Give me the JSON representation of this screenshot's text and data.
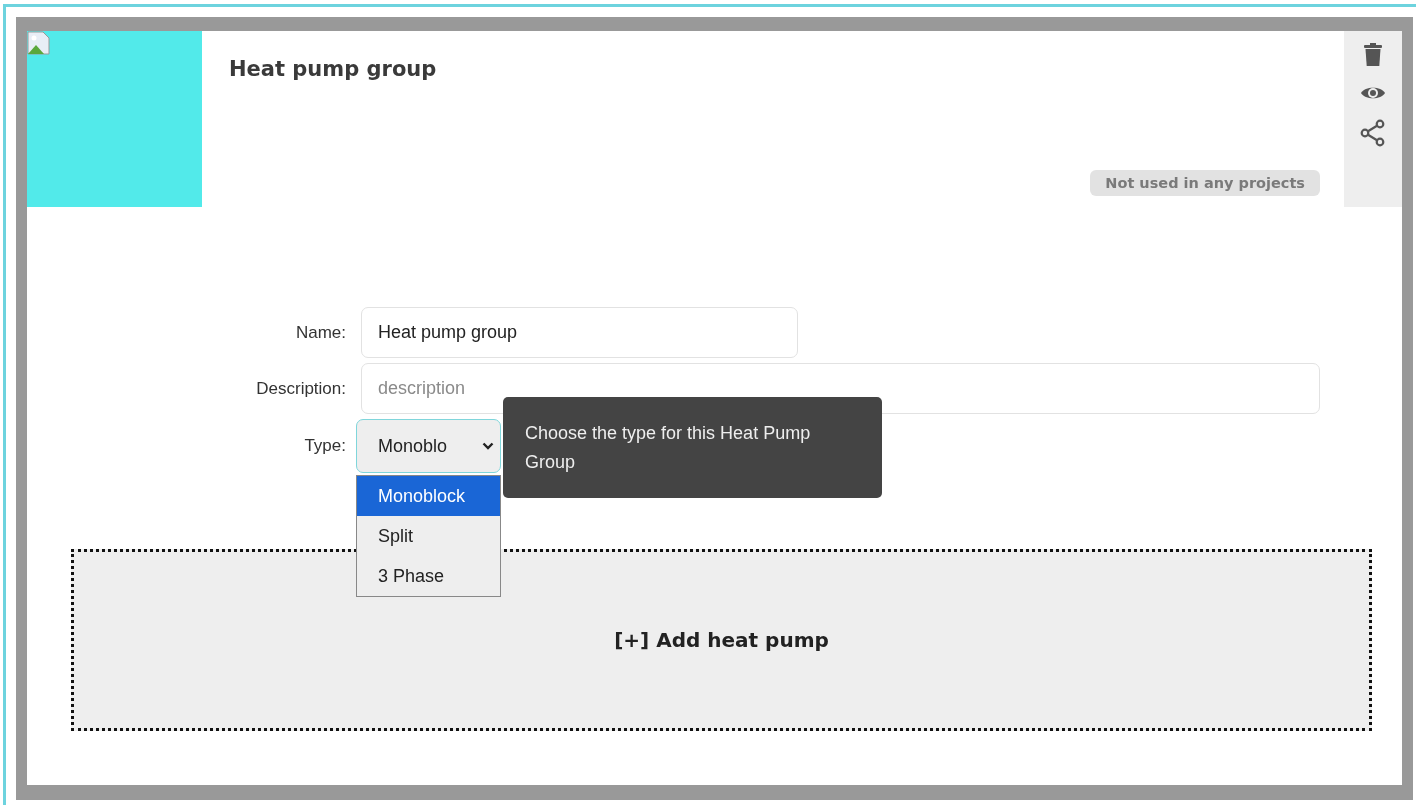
{
  "title": "Heat pump group",
  "image": {
    "broken": true
  },
  "usage_badge": "Not used in any projects",
  "actions": [
    {
      "kind": "delete"
    },
    {
      "kind": "view"
    },
    {
      "kind": "share"
    }
  ],
  "form": {
    "name": {
      "label": "Name:",
      "value": "Heat pump group"
    },
    "description": {
      "label": "Description:",
      "placeholder": "description"
    },
    "type": {
      "label": "Type:",
      "value": "Monoblo",
      "expanded": true,
      "options": [
        {
          "label": "Monoblock",
          "selected": true
        },
        {
          "label": "Split",
          "selected": false
        },
        {
          "label": "3 Phase",
          "selected": false
        }
      ]
    },
    "tooltip": "Choose the type for this Heat Pump Group"
  },
  "add_button": "[+] Add heat pump"
}
